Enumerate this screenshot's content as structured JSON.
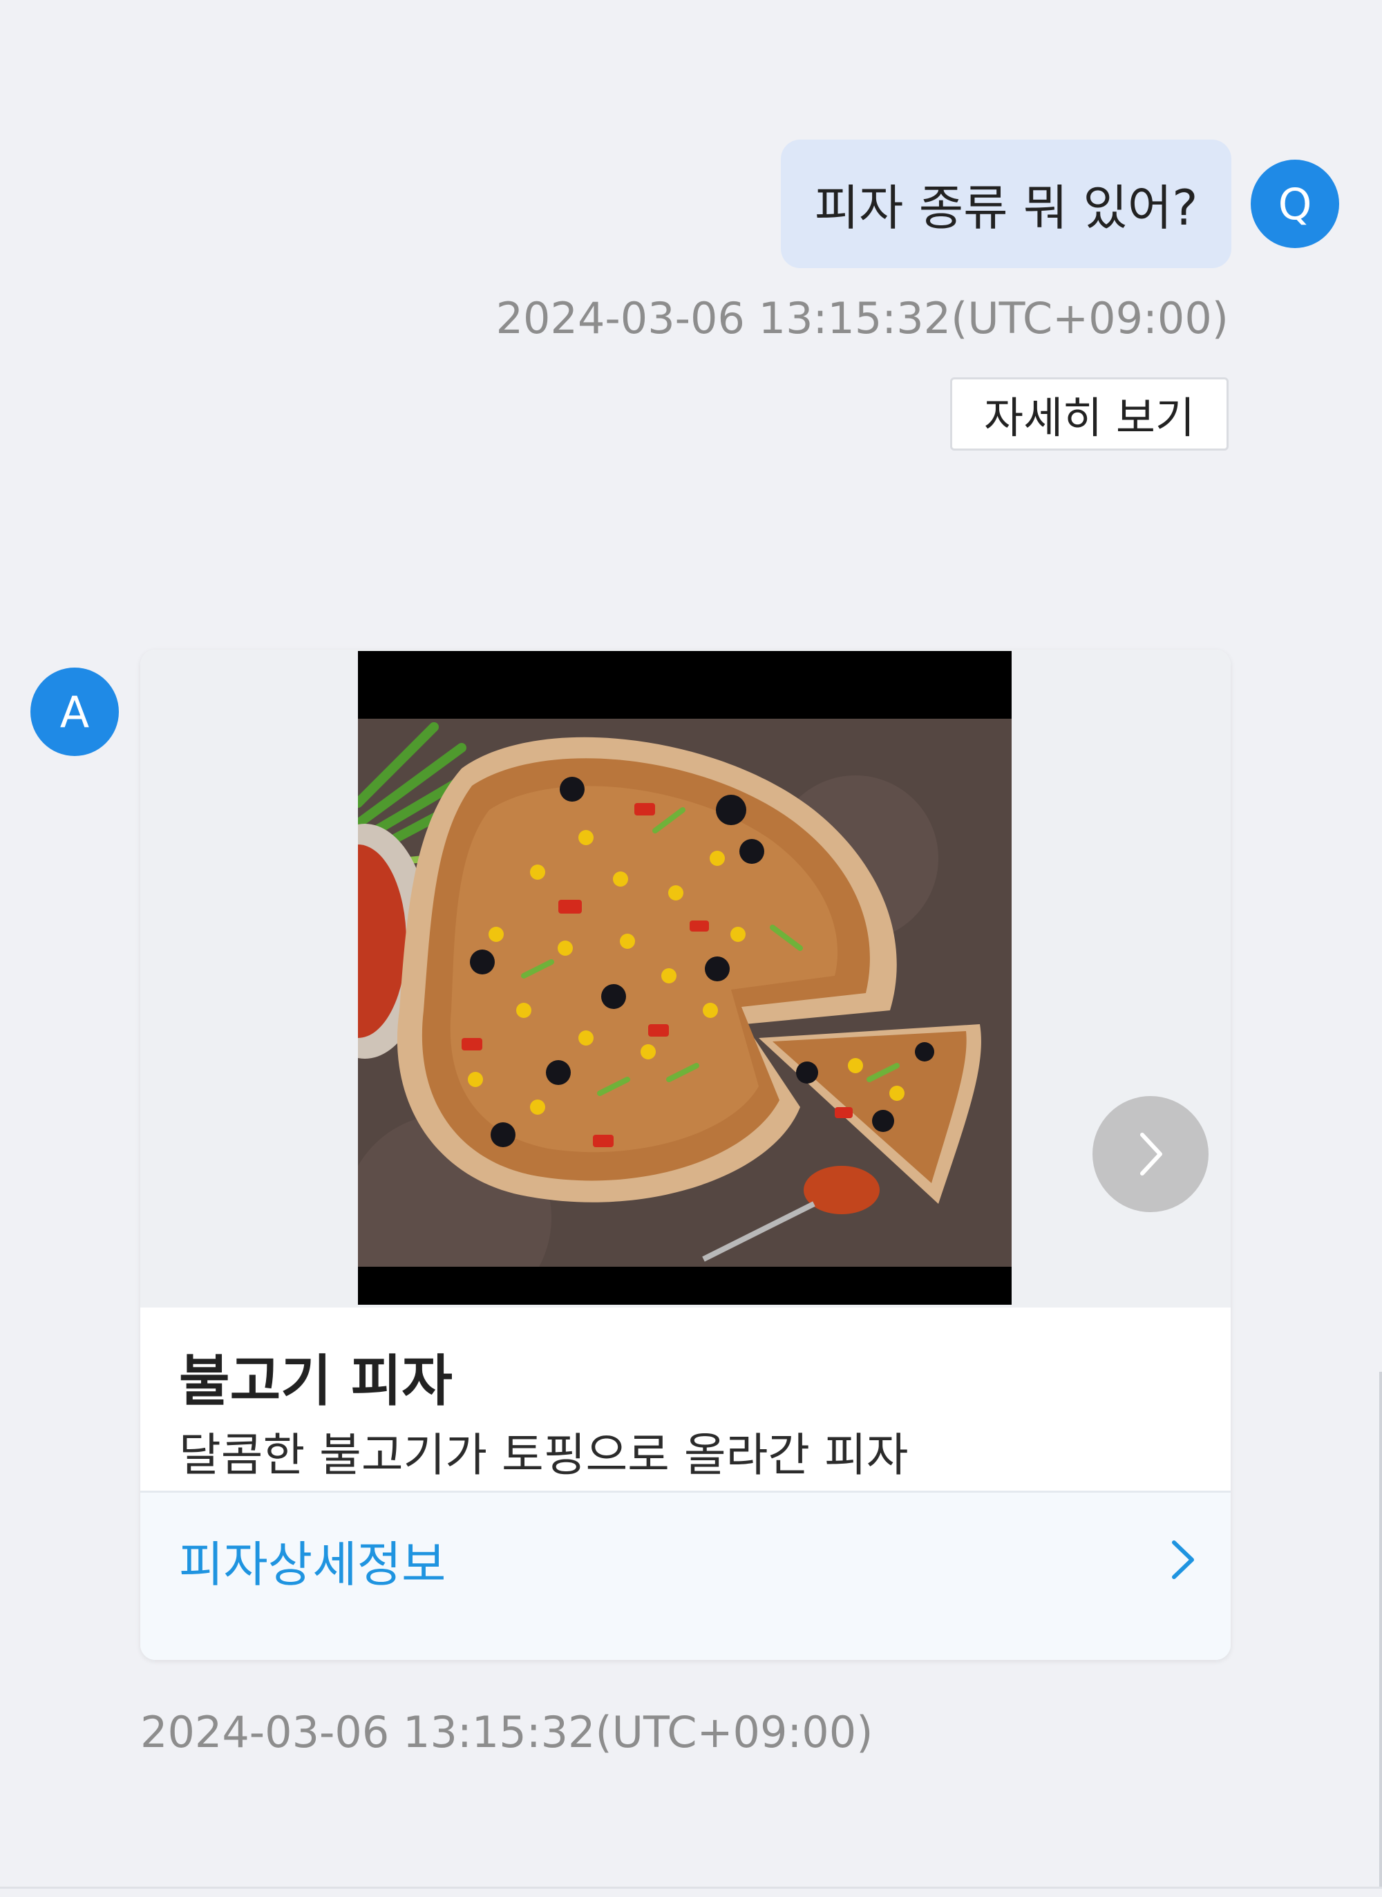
{
  "conversation": {
    "user_message": {
      "avatar_letter": "Q",
      "text": "피자 종류 뭐 있어?",
      "timestamp": "2024-03-06 13:15:32(UTC+09:00)",
      "detail_button": "자세히 보기"
    },
    "bot_message": {
      "avatar_letter": "A",
      "card": {
        "image": "pizza-photo",
        "title": "불고기 피자",
        "description": "달콤한 불고기가 토핑으로 올라간 피자",
        "link_label": "피자상세정보"
      },
      "timestamp": "2024-03-06 13:15:32(UTC+09:00)"
    }
  },
  "colors": {
    "background": "#f0f1f5",
    "avatar": "#1f8ae6",
    "user_bubble": "#dde7f8",
    "link": "#1f94e0"
  },
  "icons": {
    "carousel_next": "chevron-right-icon",
    "link_arrow": "chevron-right-icon"
  }
}
